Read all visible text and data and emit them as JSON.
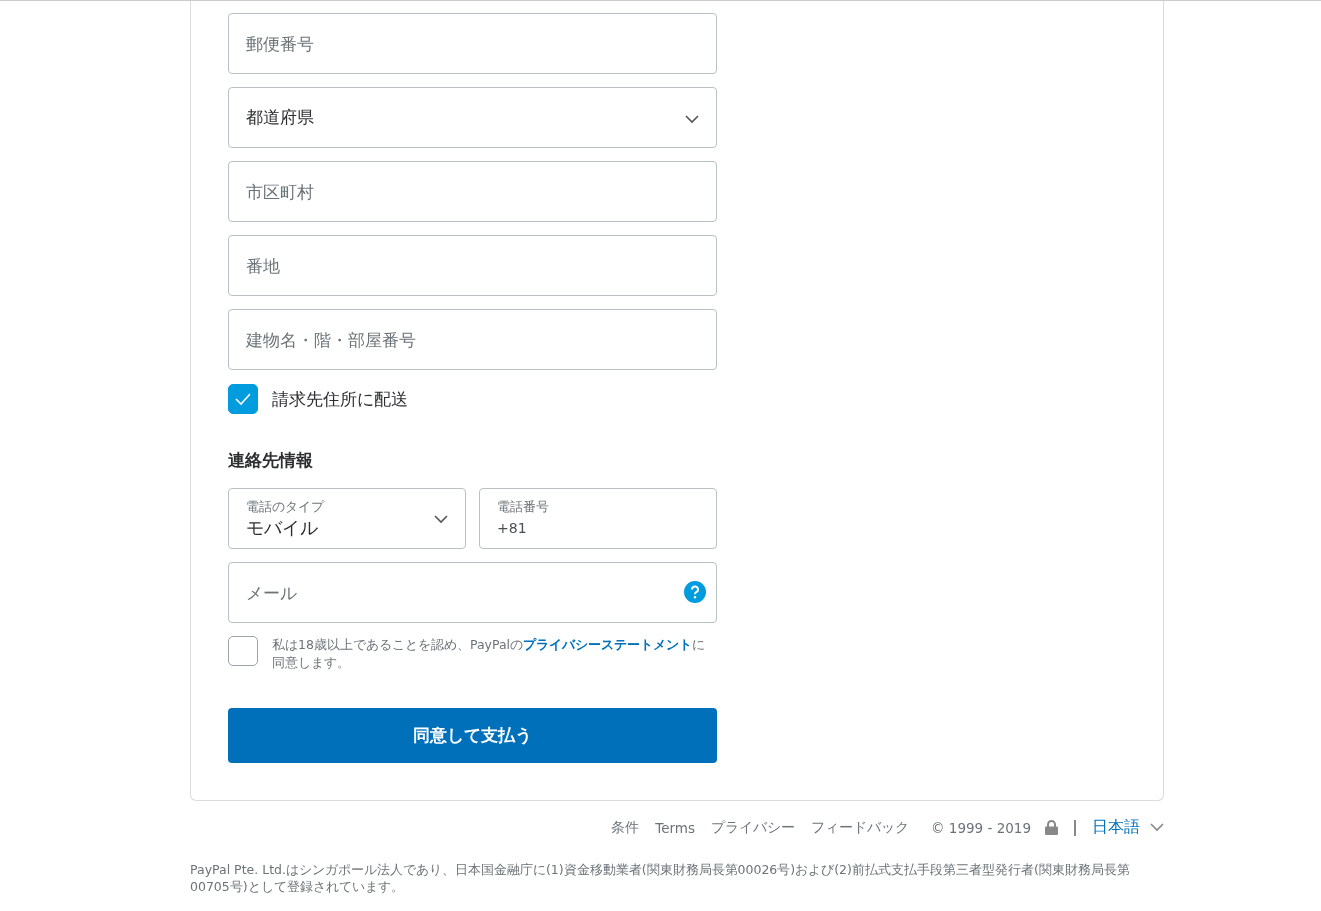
{
  "address_fields": [
    {
      "kind": "text",
      "placeholder": "郵便番号"
    },
    {
      "kind": "select",
      "value": "都道府県"
    },
    {
      "kind": "text",
      "placeholder": "市区町村"
    },
    {
      "kind": "text",
      "placeholder": "番地"
    },
    {
      "kind": "text",
      "placeholder": "建物名・階・部屋番号"
    }
  ],
  "ship_to_billing": {
    "label": "請求先住所に配送",
    "checked": true
  },
  "contact_heading": "連絡先情報",
  "phone_type": {
    "label": "電話のタイプ",
    "value": "モバイル"
  },
  "phone_number": {
    "label": "電話番号",
    "value": "+81"
  },
  "email": {
    "placeholder": "メール"
  },
  "agreement": {
    "text": "私は18歳以上であることを認め、PayPalの**プライバシーステートメント**に同意します。",
    "checked": false
  },
  "submit_button": "同意して支払う",
  "footer_links": [
    "条件",
    "Terms",
    "プライバシー",
    "フィードバック"
  ],
  "copyright": "© 1999 - 2019",
  "language": "日本語",
  "legal_text": "PayPal Pte. Ltd.はシンガポール法人であり、日本国金融庁に(1)資金移動業者(関東財務局長第00026号)および(2)前払式支払手段第三者型発行者(関東財務局長第00705号)として登録されています。"
}
